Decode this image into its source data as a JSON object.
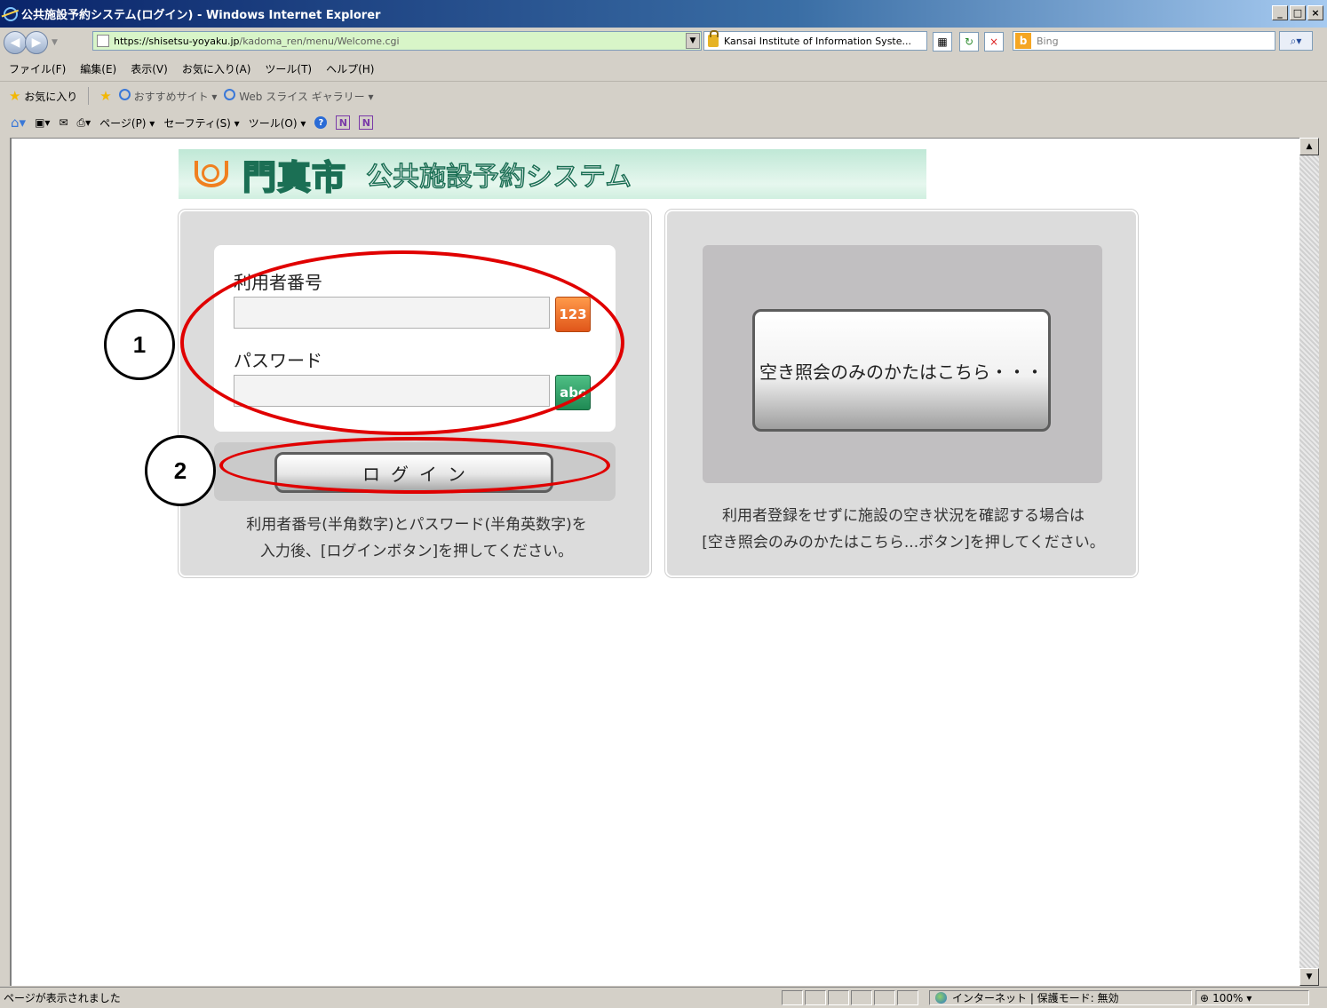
{
  "window": {
    "title": "公共施設予約システム(ログイン) - Windows Internet Explorer",
    "controls": [
      "_",
      "□",
      "×"
    ]
  },
  "addressbar": {
    "url_host": "https://shisetsu-yoyaku.jp",
    "url_path": "/kadoma_ren/menu/Welcome.cgi",
    "security_label": "Kansai Institute of Information Syste...",
    "search_placeholder": "Bing",
    "refresh_label": "↻",
    "stop_label": "×"
  },
  "menubar": {
    "items": [
      "ファイル(F)",
      "編集(E)",
      "表示(V)",
      "お気に入り(A)",
      "ツール(T)",
      "ヘルプ(H)"
    ]
  },
  "favorites_bar": {
    "favorites": "お気に入り",
    "suggested_sites": "おすすめサイト ▾",
    "web_slice": "Web スライス ギャラリー ▾"
  },
  "command_bar": {
    "page": "ページ(P) ▾",
    "safety": "セーフティ(S) ▾",
    "tools": "ツール(O) ▾"
  },
  "page": {
    "banner": {
      "city": "門真市",
      "system_name": "公共施設予約システム"
    },
    "login": {
      "user_number_label": "利用者番号",
      "password_label": "パスワード",
      "number_keypad_label": "123",
      "text_keypad_label": "abc",
      "login_button": "ログイン",
      "help_line1": "利用者番号(半角数字)とパスワード(半角英数字)を",
      "help_line2": "入力後、[ログインボタン]を押してください。"
    },
    "availability": {
      "button": "空き照会のみのかたはこちら・・・",
      "help_line1": "利用者登録をせずに施設の空き状況を確認する場合は",
      "help_line2": "[空き照会のみのかたはこちら...ボタン]を押してください。"
    }
  },
  "annotations": {
    "marker1": "1",
    "marker2": "2",
    "ring_color": "#e00000"
  },
  "statusbar": {
    "text": "ページが表示されました",
    "zone": "インターネット | 保護モード: 無効",
    "zoom": "100%"
  }
}
